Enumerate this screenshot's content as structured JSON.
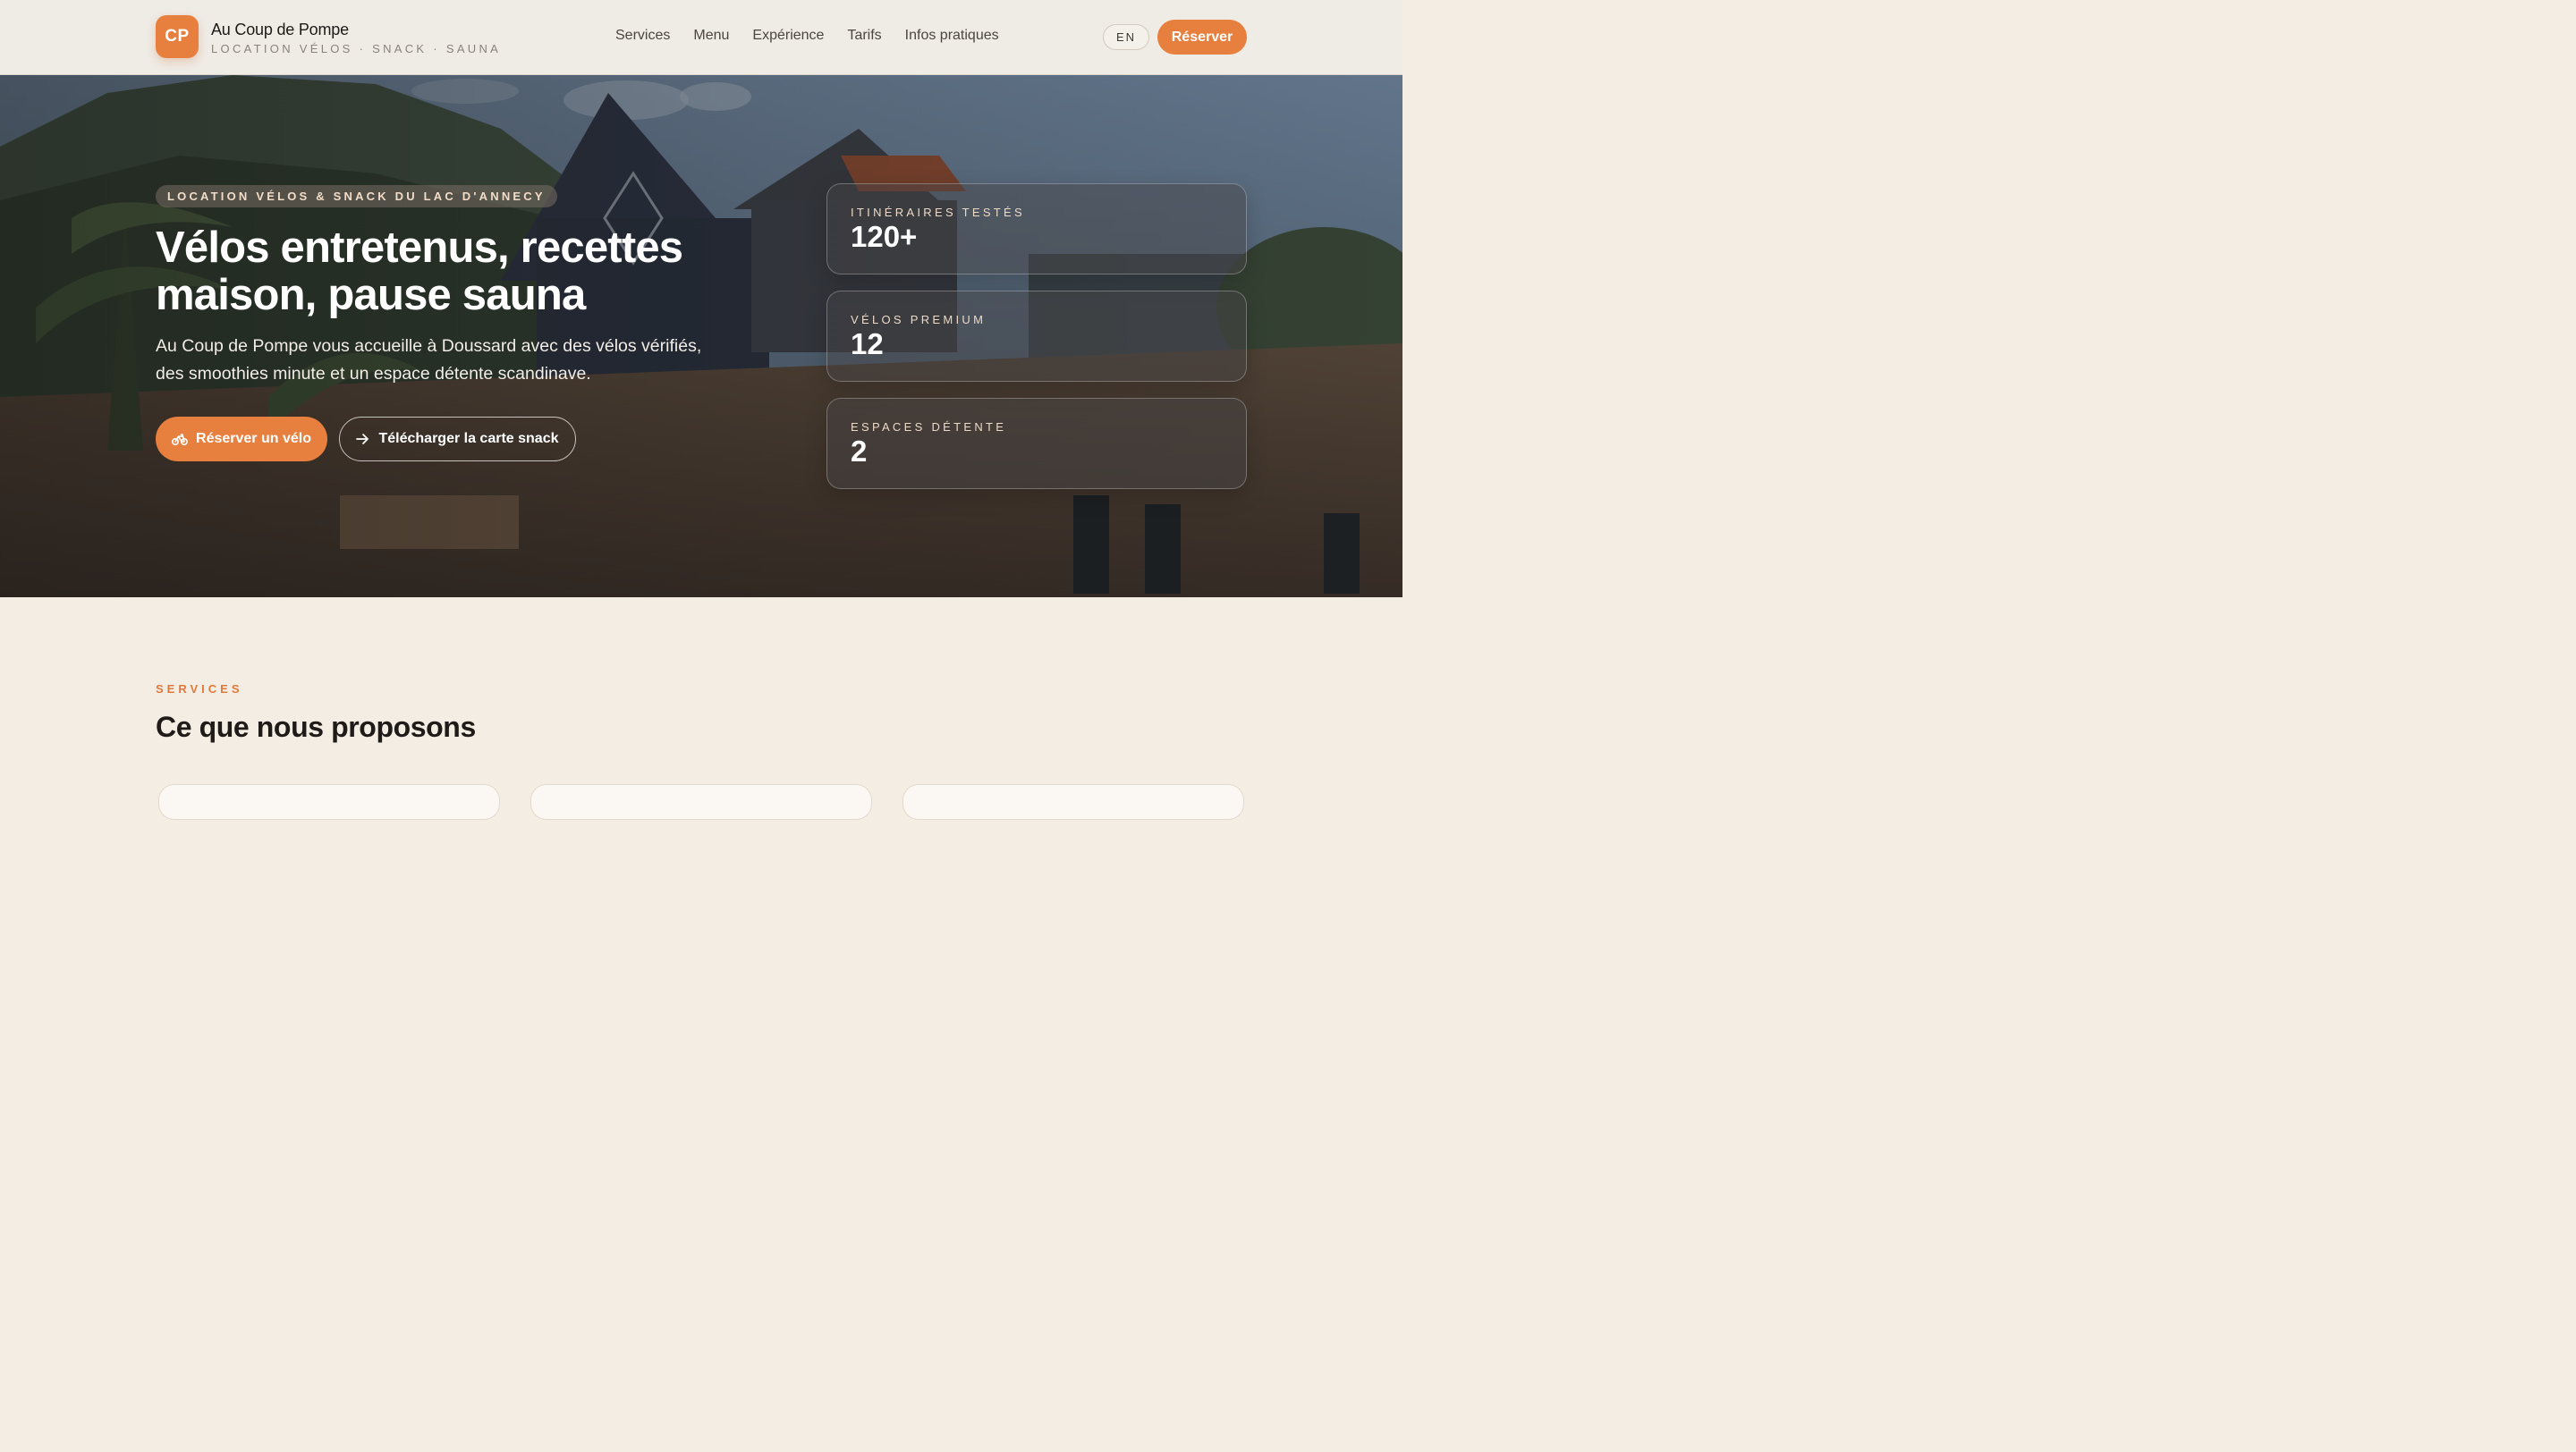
{
  "brand": {
    "badge": "CP",
    "name": "Au Coup de Pompe",
    "tagline": "LOCATION VÉLOS · SNACK · SAUNA"
  },
  "nav": {
    "items": [
      {
        "label": "Services"
      },
      {
        "label": "Menu"
      },
      {
        "label": "Expérience"
      },
      {
        "label": "Tarifs"
      },
      {
        "label": "Infos pratiques"
      }
    ],
    "lang_label": "EN",
    "book_label": "Réserver"
  },
  "hero": {
    "eyebrow": "LOCATION VÉLOS & SNACK DU LAC D'ANNECY",
    "title": "Vélos entretenus, recettes maison, pause sauna",
    "subtitle": "Au Coup de Pompe vous accueille à Doussard avec des vélos vérifiés, des smoothies minute et un espace détente scandinave.",
    "cta_primary": "Réserver un vélo",
    "cta_secondary": "Télécharger la carte snack",
    "cta_primary_icon": "bike-icon",
    "cta_secondary_icon": "arrow-right-icon"
  },
  "stats": [
    {
      "label": "ITINÉRAIRES TESTÉS",
      "value": "120+"
    },
    {
      "label": "VÉLOS PREMIUM",
      "value": "12"
    },
    {
      "label": "ESPACES DÉTENTE",
      "value": "2"
    }
  ],
  "services": {
    "eyebrow": "SERVICES",
    "title": "Ce que nous proposons"
  },
  "colors": {
    "accent": "#e7803e",
    "page_bg": "#f4ede4",
    "header_bg": "#efebe5"
  }
}
